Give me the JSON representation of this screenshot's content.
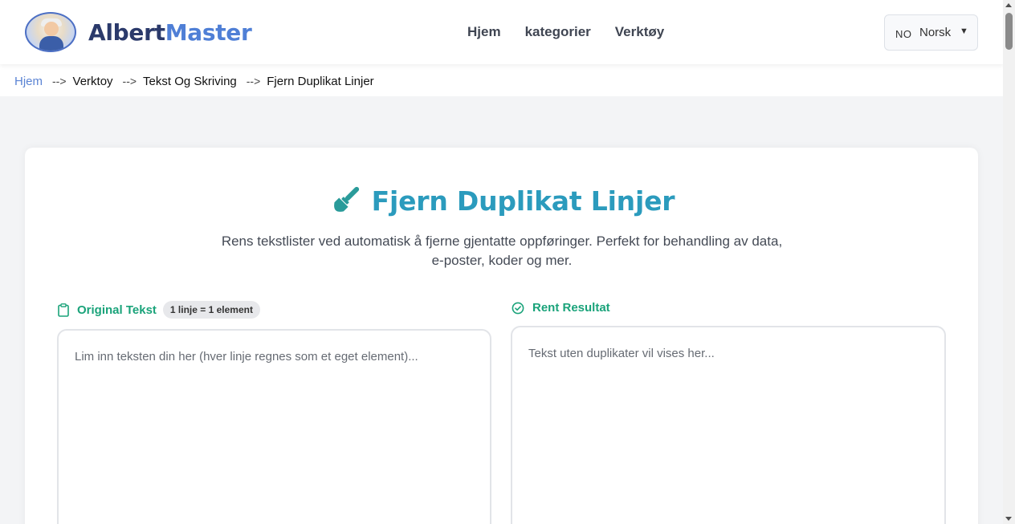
{
  "header": {
    "brand_part1": "Albert",
    "brand_part2": "Master",
    "nav": [
      "Hjem",
      "kategorier",
      "Verktøy"
    ],
    "language": {
      "code": "NO",
      "name": "Norsk"
    }
  },
  "breadcrumb": {
    "separator": "-->",
    "items": [
      "Hjem",
      "Verktoy",
      "Tekst Og Skriving",
      "Fjern Duplikat Linjer"
    ]
  },
  "tool": {
    "title": "Fjern Duplikat Linjer",
    "description": "Rens tekstlister ved automatisk å fjerne gjentatte oppføringer. Perfekt for behandling av data, e-poster, koder og mer.",
    "input": {
      "label": "Original Tekst",
      "badge": "1 linje = 1 element",
      "value": "",
      "placeholder": "Lim inn teksten din her (hver linje regnes som et eget element)..."
    },
    "output": {
      "label": "Rent Resultat",
      "value": "",
      "placeholder": "Tekst uten duplikater vil vises her..."
    }
  },
  "colors": {
    "brand_dark": "#2b3a6b",
    "brand_light": "#4f7fd6",
    "title": "#2b9bbd",
    "label_green": "#1aa37a",
    "breadcrumb_link": "#5b84d4"
  },
  "icons": {
    "logo": "albert-avatar-logo",
    "title": "paint-brush-icon",
    "input": "clipboard-icon",
    "output": "check-circle-icon",
    "lang": "caret-down-icon"
  }
}
